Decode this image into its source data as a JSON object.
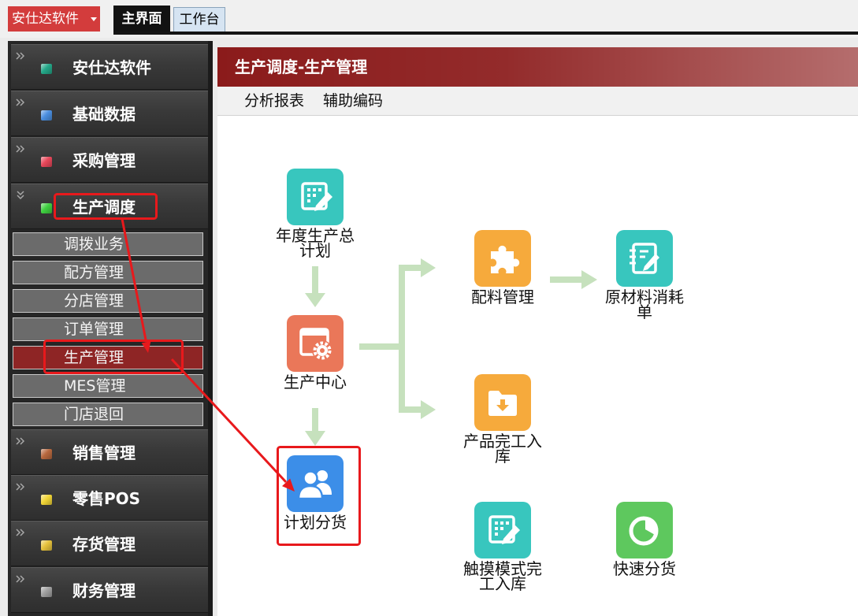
{
  "topbar": {
    "brand_button_label": "安仕达软件",
    "brand_button_icon": "caret-down-icon",
    "brand_color": "#d33c3c",
    "tabs": [
      {
        "label": "主界面",
        "active": true
      },
      {
        "label": "工作台",
        "active": false
      }
    ]
  },
  "sidebar": {
    "groups": [
      {
        "label": "安仕达软件",
        "icon": "module-icon",
        "color": "#24a889",
        "expanded": false
      },
      {
        "label": "基础数据",
        "icon": "module-icon",
        "color": "#4b8fe0",
        "expanded": false
      },
      {
        "label": "采购管理",
        "icon": "module-icon",
        "color": "#e8475a",
        "expanded": false
      },
      {
        "label": "生产调度",
        "icon": "module-icon",
        "color": "#3fd140",
        "expanded": true,
        "highlighted": true
      },
      {
        "label": "销售管理",
        "icon": "module-icon",
        "color": "#b8683e",
        "expanded": false
      },
      {
        "label": "零售POS",
        "icon": "module-icon",
        "color": "#f2d637",
        "expanded": false
      },
      {
        "label": "存货管理",
        "icon": "module-icon",
        "color": "#e6c23c",
        "expanded": false
      },
      {
        "label": "财务管理",
        "icon": "module-icon",
        "color": "#a0a0a0",
        "expanded": false
      }
    ],
    "expanded_group_items": [
      {
        "label": "调拨业务",
        "active": false
      },
      {
        "label": "配方管理",
        "active": false
      },
      {
        "label": "分店管理",
        "active": false
      },
      {
        "label": "订单管理",
        "active": false
      },
      {
        "label": "生产管理",
        "active": true,
        "highlighted": true
      },
      {
        "label": "MES管理",
        "active": false
      },
      {
        "label": "门店退回",
        "active": false
      }
    ]
  },
  "panel": {
    "title": "生产调度-生产管理",
    "header_color": "#8b1b1b",
    "toolbar": [
      "分析报表",
      "辅助编码"
    ]
  },
  "flow": {
    "arrow_color": "#c6e1bd",
    "nodes": [
      {
        "label": "年度生产总计划",
        "icon": "edit-grid-icon",
        "color": "#38c6be"
      },
      {
        "label": "生产中心",
        "icon": "window-gear-icon",
        "color": "#ea7759"
      },
      {
        "label": "计划分货",
        "icon": "users-icon",
        "color": "#3c8ee8",
        "highlighted": true
      },
      {
        "label": "配料管理",
        "icon": "puzzle-icon",
        "color": "#f6aa3c"
      },
      {
        "label": "原材料消耗单",
        "icon": "notebook-pencil-icon",
        "color": "#38c6be"
      },
      {
        "label": "产品完工入库",
        "icon": "folder-download-icon",
        "color": "#f6aa3c"
      },
      {
        "label": "触摸模式完工入库",
        "icon": "edit-grid-icon",
        "color": "#38c6be"
      },
      {
        "label": "快速分货",
        "icon": "pie-chart-icon",
        "color": "#5ec85e"
      }
    ]
  },
  "annotation_color": "#e8191c"
}
